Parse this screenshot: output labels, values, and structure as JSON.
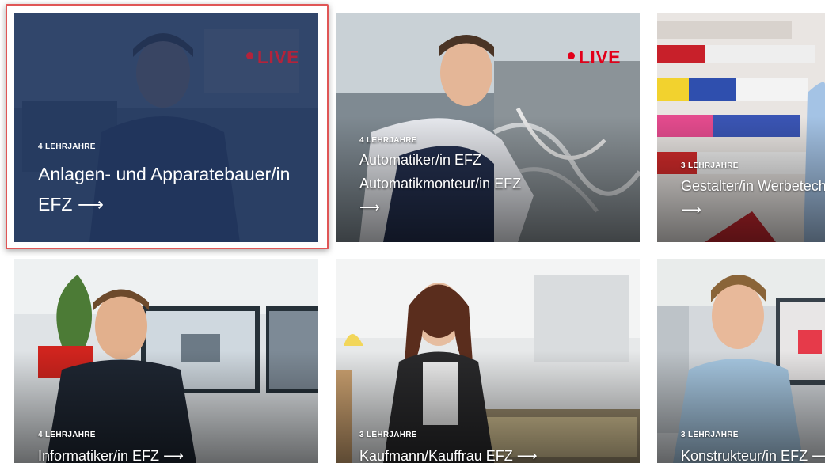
{
  "cards": [
    {
      "meta": "4 LEHRJAHRE",
      "title": "Anlagen- und Apparatebauer/in EFZ",
      "live": "LIVE",
      "arrow": "⟶",
      "state": "selected"
    },
    {
      "meta": "4 LEHRJAHRE",
      "title": "Automatiker/in EFZ Automatikmonteur/in EFZ",
      "live": "LIVE",
      "arrow": "⟶"
    },
    {
      "meta": "3 LEHRJAHRE",
      "title": "Gestalter/in Werbetechnik EFZ",
      "arrow": "⟶"
    },
    {
      "meta": "4 LEHRJAHRE",
      "title": "Informatiker/in EFZ",
      "arrow": "⟶"
    },
    {
      "meta": "3 LEHRJAHRE",
      "title": "Kaufmann/Kauffrau EFZ",
      "arrow": "⟶"
    },
    {
      "meta": "3 LEHRJAHRE",
      "title": "Konstrukteur/in EFZ",
      "arrow": "⟶"
    }
  ],
  "colors": {
    "live_red": "#e2001a",
    "selected_overlay": "#1f345c",
    "selection_border": "#e05656"
  }
}
